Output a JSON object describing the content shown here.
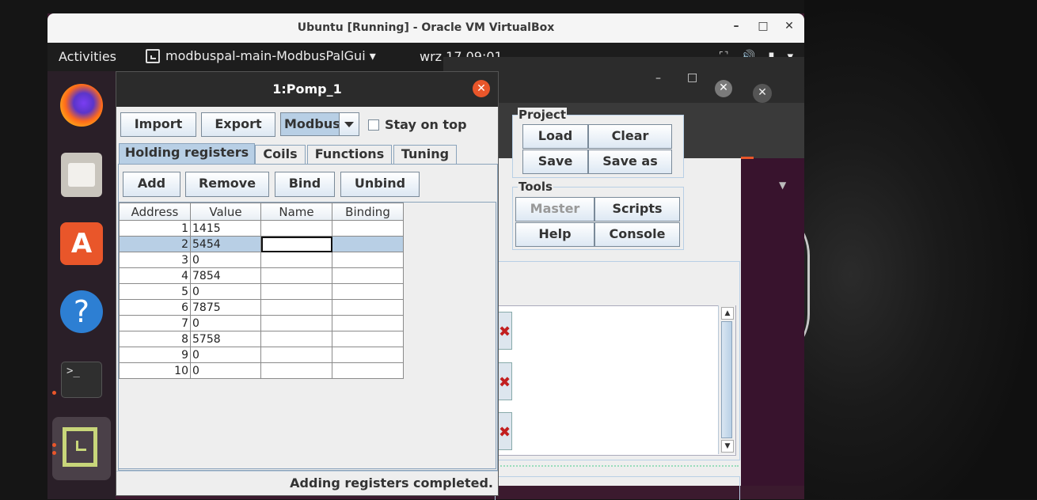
{
  "vbox": {
    "title": "Ubuntu [Running] - Oracle VM VirtualBox",
    "minimize": "–",
    "maximize": "□",
    "close": "✕"
  },
  "topbar": {
    "activities": "Activities",
    "app_name": "modbuspal-main-ModbusPalGui ▾",
    "clock": "wrz 17  09:01",
    "tray": [
      "⛶",
      "🔊",
      "▮",
      "▾"
    ]
  },
  "dock": {
    "items": [
      "firefox-icon",
      "files-icon",
      "software-center-icon",
      "help-icon",
      "terminal-icon",
      "modbuspal-icon"
    ],
    "store_glyph": "A",
    "help_glyph": "?",
    "terminal_glyph": ">_"
  },
  "main_window": {
    "minimize": "–",
    "maximize": "□",
    "close": "✕",
    "ext_close": "✕",
    "project": {
      "title": "Project",
      "load": "Load",
      "clear": "Clear",
      "save": "Save",
      "save_as": "Save as"
    },
    "tools": {
      "title": "Tools",
      "master": "Master",
      "scripts": "Scripts",
      "help": "Help",
      "console": "Console"
    },
    "scroll_up": "▲",
    "scroll_down": "▼"
  },
  "dialog": {
    "title": "1:Pomp_1",
    "close": "✕",
    "import_label": "Import",
    "export_label": "Export",
    "protocol": "Modbus",
    "stay_on_top": "Stay on top",
    "tabs": [
      "Holding registers",
      "Coils",
      "Functions",
      "Tuning"
    ],
    "add_label": "Add",
    "remove_label": "Remove",
    "bind_label": "Bind",
    "unbind_label": "Unbind",
    "columns": [
      "Address",
      "Value",
      "Name",
      "Binding"
    ],
    "rows": [
      {
        "address": "1",
        "value": "1415",
        "name": "",
        "binding": ""
      },
      {
        "address": "2",
        "value": "5454",
        "name": "",
        "binding": ""
      },
      {
        "address": "3",
        "value": "0",
        "name": "",
        "binding": ""
      },
      {
        "address": "4",
        "value": "7854",
        "name": "",
        "binding": ""
      },
      {
        "address": "5",
        "value": "0",
        "name": "",
        "binding": ""
      },
      {
        "address": "6",
        "value": "7875",
        "name": "",
        "binding": ""
      },
      {
        "address": "7",
        "value": "0",
        "name": "",
        "binding": ""
      },
      {
        "address": "8",
        "value": "5758",
        "name": "",
        "binding": ""
      },
      {
        "address": "9",
        "value": "0",
        "name": "",
        "binding": ""
      },
      {
        "address": "10",
        "value": "0",
        "name": "",
        "binding": ""
      }
    ],
    "status": "Adding registers completed."
  }
}
